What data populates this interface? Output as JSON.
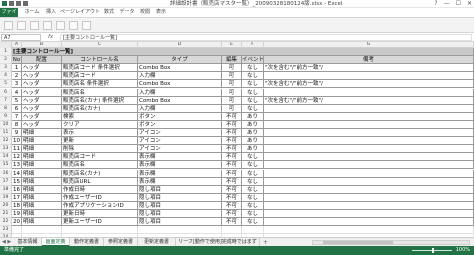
{
  "window": {
    "title": "詳細設計書（販売店マスタ一覧）_20090328180124版.xlsx - Excel",
    "controls": [
      "?",
      "—",
      "☐",
      "✕"
    ]
  },
  "ribbon": {
    "tabs": [
      "ファイル",
      "ホーム",
      "挿入",
      "ページレイアウト",
      "数式",
      "データ",
      "校閲",
      "表示"
    ]
  },
  "formula_bar": {
    "name_box": "A7",
    "fx": "fx",
    "content": "[主要コントロール一覧]"
  },
  "columns": [
    "A",
    "B",
    "C",
    "D",
    "E",
    "F",
    "G"
  ],
  "sheet": {
    "title": "[主要コントロール一覧]",
    "headers": [
      "No",
      "配置",
      "コントロール名",
      "タイプ",
      "編集",
      "イベント",
      "備考"
    ],
    "rows": [
      [
        "1",
        "ヘッダ",
        "販売店コード 条件選択",
        "Combo Box",
        "可",
        "なし",
        "\"次を含む\"/\"前方一致\"/"
      ],
      [
        "2",
        "ヘッダ",
        "販売店コード",
        "入力欄",
        "可",
        "なし",
        ""
      ],
      [
        "3",
        "ヘッダ",
        "販売店名 条件選択",
        "Combo Box",
        "可",
        "なし",
        "\"次を含む\"/\"前方一致\"/"
      ],
      [
        "4",
        "ヘッダ",
        "販売店名",
        "入力欄",
        "可",
        "なし",
        ""
      ],
      [
        "5",
        "ヘッダ",
        "販売店名(カナ) 条件選択",
        "Combo Box",
        "可",
        "なし",
        "\"次を含む\"/\"前方一致\"/"
      ],
      [
        "6",
        "ヘッダ",
        "販売店名(カナ)",
        "入力欄",
        "可",
        "なし",
        ""
      ],
      [
        "7",
        "ヘッダ",
        "検索",
        "ボタン",
        "不可",
        "あり",
        ""
      ],
      [
        "8",
        "ヘッダ",
        "クリア",
        "ボタン",
        "不可",
        "あり",
        ""
      ],
      [
        "9",
        "明細",
        "表示",
        "アイコン",
        "不可",
        "あり",
        ""
      ],
      [
        "10",
        "明細",
        "更新",
        "アイコン",
        "不可",
        "あり",
        ""
      ],
      [
        "11",
        "明細",
        "削除",
        "アイコン",
        "不可",
        "あり",
        ""
      ],
      [
        "12",
        "明細",
        "販売店コード",
        "表示欄",
        "不可",
        "なし",
        ""
      ],
      [
        "13",
        "明細",
        "販売店名",
        "表示欄",
        "不可",
        "なし",
        ""
      ],
      [
        "14",
        "明細",
        "販売店名(カナ)",
        "表示欄",
        "不可",
        "なし",
        ""
      ],
      [
        "15",
        "明細",
        "販売店URL",
        "表示欄",
        "不可",
        "なし",
        ""
      ],
      [
        "16",
        "明細",
        "作成日時",
        "隠し項目",
        "不可",
        "なし",
        ""
      ],
      [
        "17",
        "明細",
        "作成ユーザーID",
        "隠し項目",
        "不可",
        "なし",
        ""
      ],
      [
        "18",
        "明細",
        "作成アプリケーションID",
        "隠し項目",
        "不可",
        "なし",
        ""
      ],
      [
        "19",
        "明細",
        "更新日時",
        "隠し項目",
        "不可",
        "なし",
        ""
      ],
      [
        "20",
        "明細",
        "更新ユーザーID",
        "隠し項目",
        "不可",
        "なし",
        ""
      ]
    ],
    "row_numbers": [
      "1",
      "2",
      "3",
      "4",
      "5",
      "6",
      "7",
      "8",
      "9",
      "10",
      "11",
      "12",
      "13",
      "14",
      "15",
      "16",
      "17",
      "18",
      "19",
      "20",
      "21",
      "22",
      "23",
      "24"
    ]
  },
  "sheet_tabs": {
    "nav": "◀ ▶",
    "tabs": [
      "基本情報",
      "画面定義",
      "動作定義書",
      "参照定義書",
      "更新定義書",
      "リーフ[動作で使用]完成時ではまず"
    ],
    "active_index": 1,
    "add": "+"
  },
  "status": {
    "left": "準備完了",
    "zoom": "100%"
  },
  "colors": {
    "excel_green": "#217346"
  }
}
